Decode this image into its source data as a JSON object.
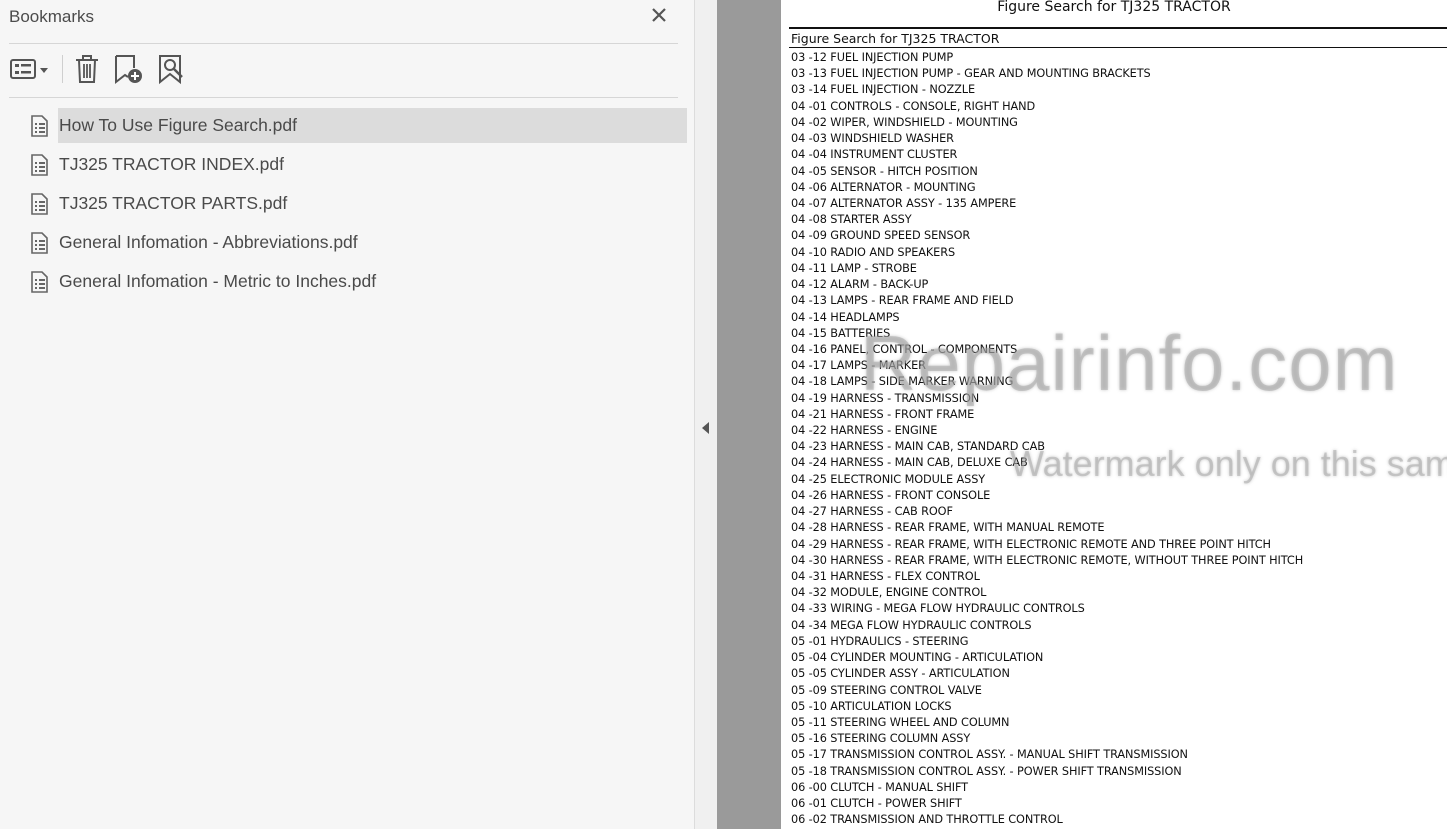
{
  "bookmarks": {
    "title": "Bookmarks",
    "toolbar": {
      "options_icon": "options-menu-icon",
      "delete_icon": "trash-icon",
      "add_icon": "add-bookmark-icon",
      "search_icon": "find-bookmark-icon"
    },
    "items": [
      {
        "label": "How To Use Figure Search.pdf",
        "selected": true
      },
      {
        "label": "TJ325 TRACTOR INDEX.pdf",
        "selected": false
      },
      {
        "label": "TJ325 TRACTOR PARTS.pdf",
        "selected": false
      },
      {
        "label": "General Infomation - Abbreviations.pdf",
        "selected": false
      },
      {
        "label": "General Infomation - Metric to Inches.pdf",
        "selected": false
      }
    ]
  },
  "document": {
    "title": "Figure Search for TJ325 TRACTOR",
    "subtitle": "Figure Search for TJ325 TRACTOR",
    "lines": [
      "03 -12 FUEL INJECTION PUMP",
      "03 -13 FUEL INJECTION PUMP - GEAR AND MOUNTING BRACKETS",
      "03 -14 FUEL INJECTION - NOZZLE",
      "04 -01 CONTROLS - CONSOLE, RIGHT HAND",
      "04 -02 WIPER, WINDSHIELD - MOUNTING",
      "04 -03 WINDSHIELD WASHER",
      "04 -04 INSTRUMENT CLUSTER",
      "04 -05 SENSOR - HITCH POSITION",
      "04 -06 ALTERNATOR - MOUNTING",
      "04 -07 ALTERNATOR ASSY - 135 AMPERE",
      "04 -08 STARTER ASSY",
      "04 -09 GROUND SPEED SENSOR",
      "04 -10 RADIO AND SPEAKERS",
      "04 -11 LAMP - STROBE",
      "04 -12 ALARM - BACK-UP",
      "04 -13 LAMPS - REAR FRAME AND FIELD",
      "04 -14 HEADLAMPS",
      "04 -15 BATTERIES",
      "04 -16 PANEL, CONTROL - COMPONENTS",
      "04 -17 LAMPS - MARKER",
      "04 -18 LAMPS - SIDE MARKER WARNING",
      "04 -19 HARNESS - TRANSMISSION",
      "04 -21 HARNESS - FRONT FRAME",
      "04 -22 HARNESS - ENGINE",
      "04 -23 HARNESS - MAIN CAB, STANDARD CAB",
      "04 -24 HARNESS - MAIN CAB, DELUXE CAB",
      "04 -25 ELECTRONIC MODULE ASSY",
      "04 -26 HARNESS - FRONT CONSOLE",
      "04 -27 HARNESS - CAB ROOF",
      "04 -28 HARNESS - REAR FRAME, WITH MANUAL REMOTE",
      "04 -29 HARNESS - REAR FRAME, WITH ELECTRONIC REMOTE AND THREE POINT HITCH",
      "04 -30 HARNESS - REAR FRAME, WITH ELECTRONIC REMOTE, WITHOUT THREE POINT HITCH",
      "04 -31 HARNESS - FLEX CONTROL",
      "04 -32 MODULE, ENGINE CONTROL",
      "04 -33 WIRING - MEGA FLOW HYDRAULIC CONTROLS",
      "04 -34 MEGA FLOW HYDRAULIC CONTROLS",
      "05 -01 HYDRAULICS - STEERING",
      "05 -04 CYLINDER MOUNTING - ARTICULATION",
      "05 -05 CYLINDER ASSY - ARTICULATION",
      "05 -09 STEERING CONTROL VALVE",
      "05 -10 ARTICULATION LOCKS",
      "05 -11 STEERING WHEEL AND COLUMN",
      "05 -16 STEERING COLUMN ASSY",
      "05 -17 TRANSMISSION CONTROL ASSY. - MANUAL SHIFT TRANSMISSION",
      "05 -18 TRANSMISSION CONTROL ASSY. - POWER SHIFT TRANSMISSION",
      "06 -00 CLUTCH - MANUAL SHIFT",
      "06 -01 CLUTCH - POWER SHIFT",
      "06 -02 TRANSMISSION AND THROTTLE CONTROL"
    ]
  },
  "watermark": {
    "line1": "Repairinfo.com",
    "line2": "Watermark only on this sample"
  }
}
